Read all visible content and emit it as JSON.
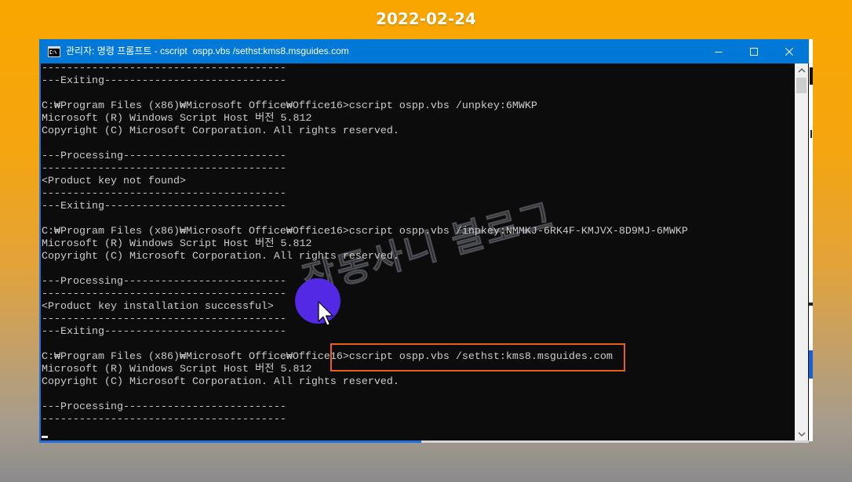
{
  "page": {
    "date": "2022-02-24"
  },
  "theme": {
    "background_top": "#FAA600",
    "background_bottom": "#8B8B8B",
    "titlebar": "#0078D7",
    "console_background": "#0C0C0C",
    "console_text": "#CCCCCC",
    "highlight": "#E8601E",
    "click_indicator": "#5429E6"
  },
  "window": {
    "title": "관리자: 명령 프롬프트 - cscript  ospp.vbs /sethst:kms8.msguides.com",
    "icon": "cmd-icon",
    "controls": [
      "minimize-icon",
      "maximize-icon",
      "close-icon"
    ]
  },
  "console": {
    "lines": [
      "---------------------------------------",
      "---Exiting-----------------------------",
      "",
      "C:₩Program Files (x86)₩Microsoft Office₩Office16>cscript ospp.vbs /unpkey:6MWKP",
      "Microsoft (R) Windows Script Host 버전 5.812",
      "Copyright (C) Microsoft Corporation. All rights reserved.",
      "",
      "---Processing--------------------------",
      "---------------------------------------",
      "<Product key not found>",
      "---------------------------------------",
      "---Exiting-----------------------------",
      "",
      "C:₩Program Files (x86)₩Microsoft Office₩Office16>cscript ospp.vbs /inpkey:NMMKJ-6RK4F-KMJVX-8D9MJ-6MWKP",
      "Microsoft (R) Windows Script Host 버전 5.812",
      "Copyright (C) Microsoft Corporation. All rights reserved.",
      "",
      "---Processing--------------------------",
      "---------------------------------------",
      "<Product key installation successful>",
      "---------------------------------------",
      "---Exiting-----------------------------",
      "",
      "C:₩Program Files (x86)₩Microsoft Office₩Office16>cscript ospp.vbs /sethst:kms8.msguides.com",
      "Microsoft (R) Windows Script Host 버전 5.812",
      "Copyright (C) Microsoft Corporation. All rights reserved.",
      "",
      "---Processing--------------------------",
      "---------------------------------------"
    ]
  },
  "scrollbar": {
    "up_icon": "scroll-up-icon",
    "down_icon": "scroll-down-icon"
  },
  "watermark": {
    "text": "잡동사니 블로그"
  },
  "pointer": {
    "icon": "mouse-cursor-icon"
  }
}
